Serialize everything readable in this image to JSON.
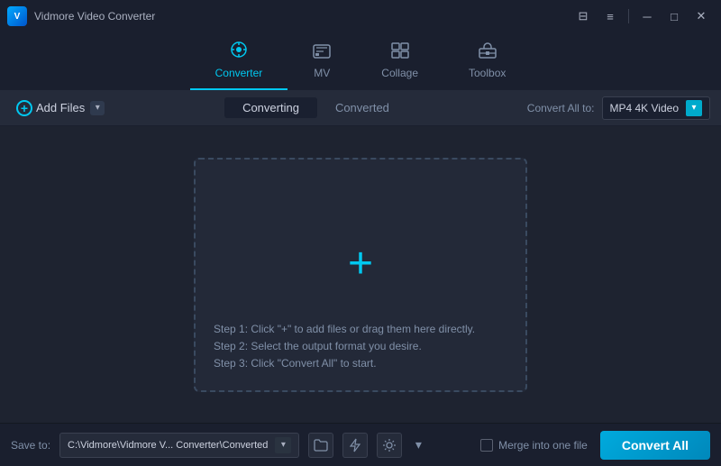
{
  "app": {
    "logo_text": "V",
    "title": "Vidmore Video Converter"
  },
  "title_bar": {
    "controls": {
      "message_icon": "⊟",
      "menu_icon": "≡",
      "minimize_icon": "─",
      "maximize_icon": "□",
      "close_icon": "✕"
    }
  },
  "nav": {
    "tabs": [
      {
        "id": "converter",
        "label": "Converter",
        "icon": "⊙",
        "active": true
      },
      {
        "id": "mv",
        "label": "MV",
        "icon": "🖼"
      },
      {
        "id": "collage",
        "label": "Collage",
        "icon": "▦"
      },
      {
        "id": "toolbox",
        "label": "Toolbox",
        "icon": "🧰"
      }
    ]
  },
  "toolbar": {
    "add_files_label": "Add Files",
    "tabs": [
      {
        "id": "converting",
        "label": "Converting",
        "active": true
      },
      {
        "id": "converted",
        "label": "Converted",
        "active": false
      }
    ],
    "convert_all_to_label": "Convert All to:",
    "format_value": "MP4 4K Video"
  },
  "drop_zone": {
    "plus_symbol": "+",
    "steps": [
      "Step 1: Click \"+\" to add files or drag them here directly.",
      "Step 2: Select the output format you desire.",
      "Step 3: Click \"Convert All\" to start."
    ]
  },
  "bottom_bar": {
    "save_to_label": "Save to:",
    "save_path": "C:\\Vidmore\\Vidmore V... Converter\\Converted",
    "merge_label": "Merge into one file",
    "convert_all_label": "Convert All"
  }
}
